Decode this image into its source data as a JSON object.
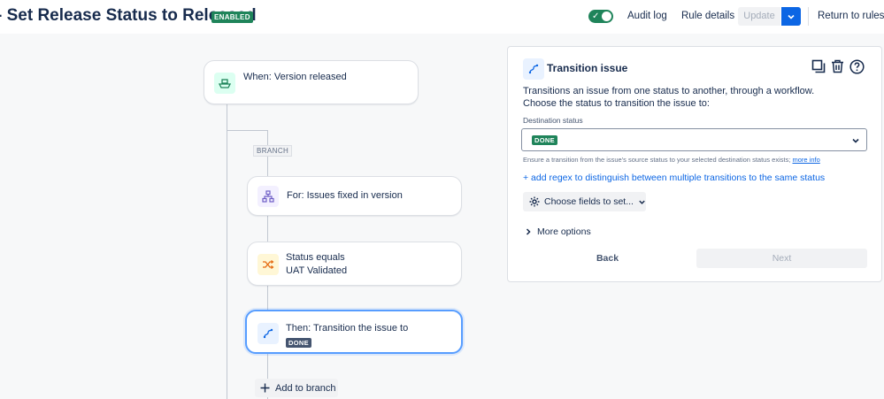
{
  "header": {
    "title": "- Set Release Status to Released",
    "status_badge": "ENABLED",
    "audit_log": "Audit log",
    "rule_details": "Rule details",
    "update": "Update",
    "return": "Return to rules"
  },
  "flow": {
    "trigger": "When: Version released",
    "branch_label": "BRANCH",
    "for_step": "For: Issues fixed in version",
    "condition_line1": "Status equals",
    "condition_line2": "UAT Validated",
    "action_line1": "Then: Transition the issue to",
    "action_badge": "DONE",
    "add_branch": "Add to branch"
  },
  "panel": {
    "title": "Transition issue",
    "desc_line1": "Transitions an issue from one status to another, through a workflow.",
    "desc_line2": "Choose the status to transition the issue to:",
    "field_label": "Destination status",
    "selected_status": "DONE",
    "helper_text": "Ensure a transition from the issue's source status to your selected destination status exists;",
    "helper_link": "more info",
    "regex_link": "+ add regex to distinguish between multiple transitions to the same status",
    "choose_fields": "Choose fields to set...",
    "more_options": "More options",
    "back": "Back",
    "next": "Next"
  },
  "colors": {
    "enabled": "#1f845a",
    "primary": "#0c66e4",
    "selected_border": "#579dff"
  }
}
